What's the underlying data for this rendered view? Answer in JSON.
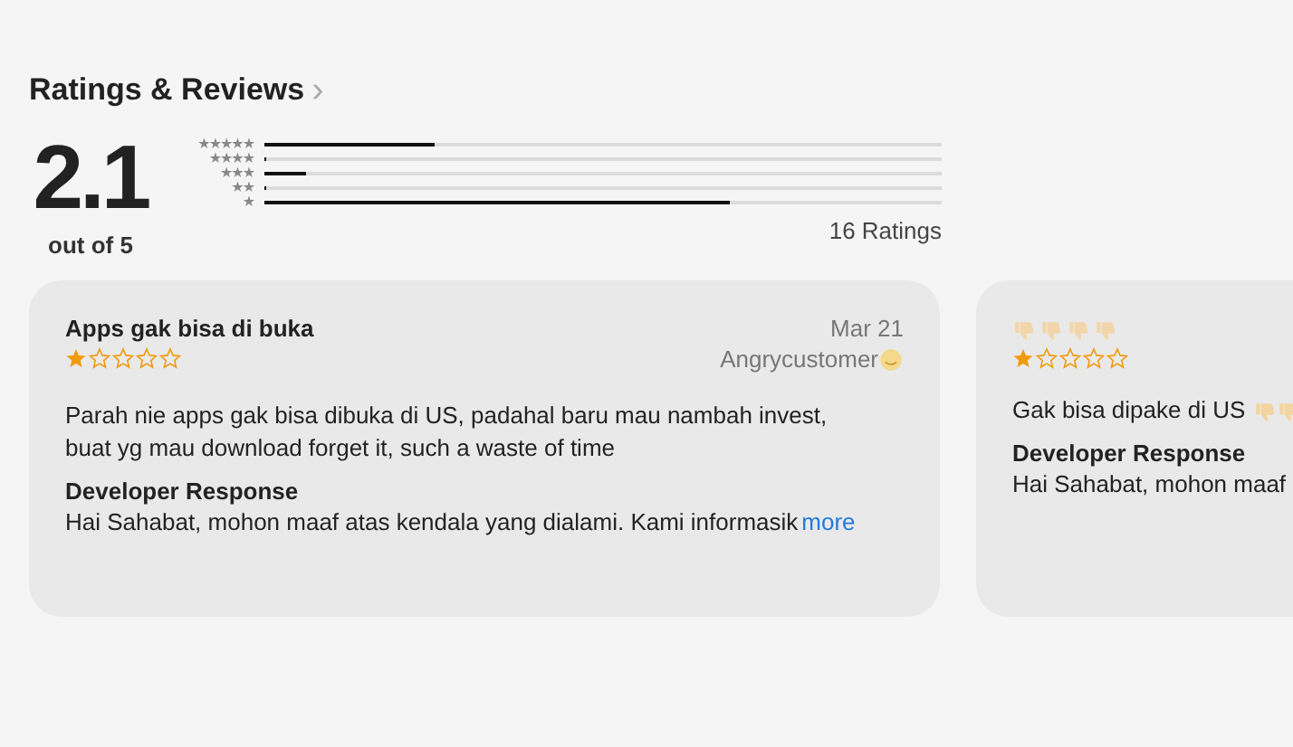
{
  "section": {
    "title": "Ratings & Reviews",
    "chevron": "›"
  },
  "summary": {
    "score": "2.1",
    "out_of": "out of 5",
    "count": "16 Ratings"
  },
  "histogram": [
    {
      "label": "★★★★★",
      "level": 0.25
    },
    {
      "label": "★★★★",
      "level": 0
    },
    {
      "label": "★★★",
      "level": 0.0625
    },
    {
      "label": "★★",
      "level": 0
    },
    {
      "label": "★",
      "level": 0.6875
    }
  ],
  "reviews": [
    {
      "title": "Apps gak bisa di buka",
      "date": "Mar 21",
      "author": "Angrycustomer",
      "author_emoji": [
        {
          "kind": "smiley"
        }
      ],
      "stars": 1,
      "body": "Parah nie apps gak bisa dibuka di US, padahal baru mau nambah invest, buat yg mau download forget it, such a waste of time",
      "response_label": "Developer Response",
      "response": "Hai Sahabat, mohon maaf atas kendala yang dialami. Kami informasik",
      "more": "more"
    },
    {
      "title_emoji": [
        {
          "kind": "thumbs-down"
        },
        {
          "kind": "thumbs-down"
        },
        {
          "kind": "thumbs-down"
        },
        {
          "kind": "thumbs-down"
        }
      ],
      "stars": 1,
      "body": "Gak bisa dipake di US",
      "body_emoji": [
        {
          "kind": "thumbs-down"
        },
        {
          "kind": "thumbs-down"
        }
      ],
      "response_label": "Developer Response",
      "response": "Hai Sahabat, mohon maaf"
    }
  ]
}
